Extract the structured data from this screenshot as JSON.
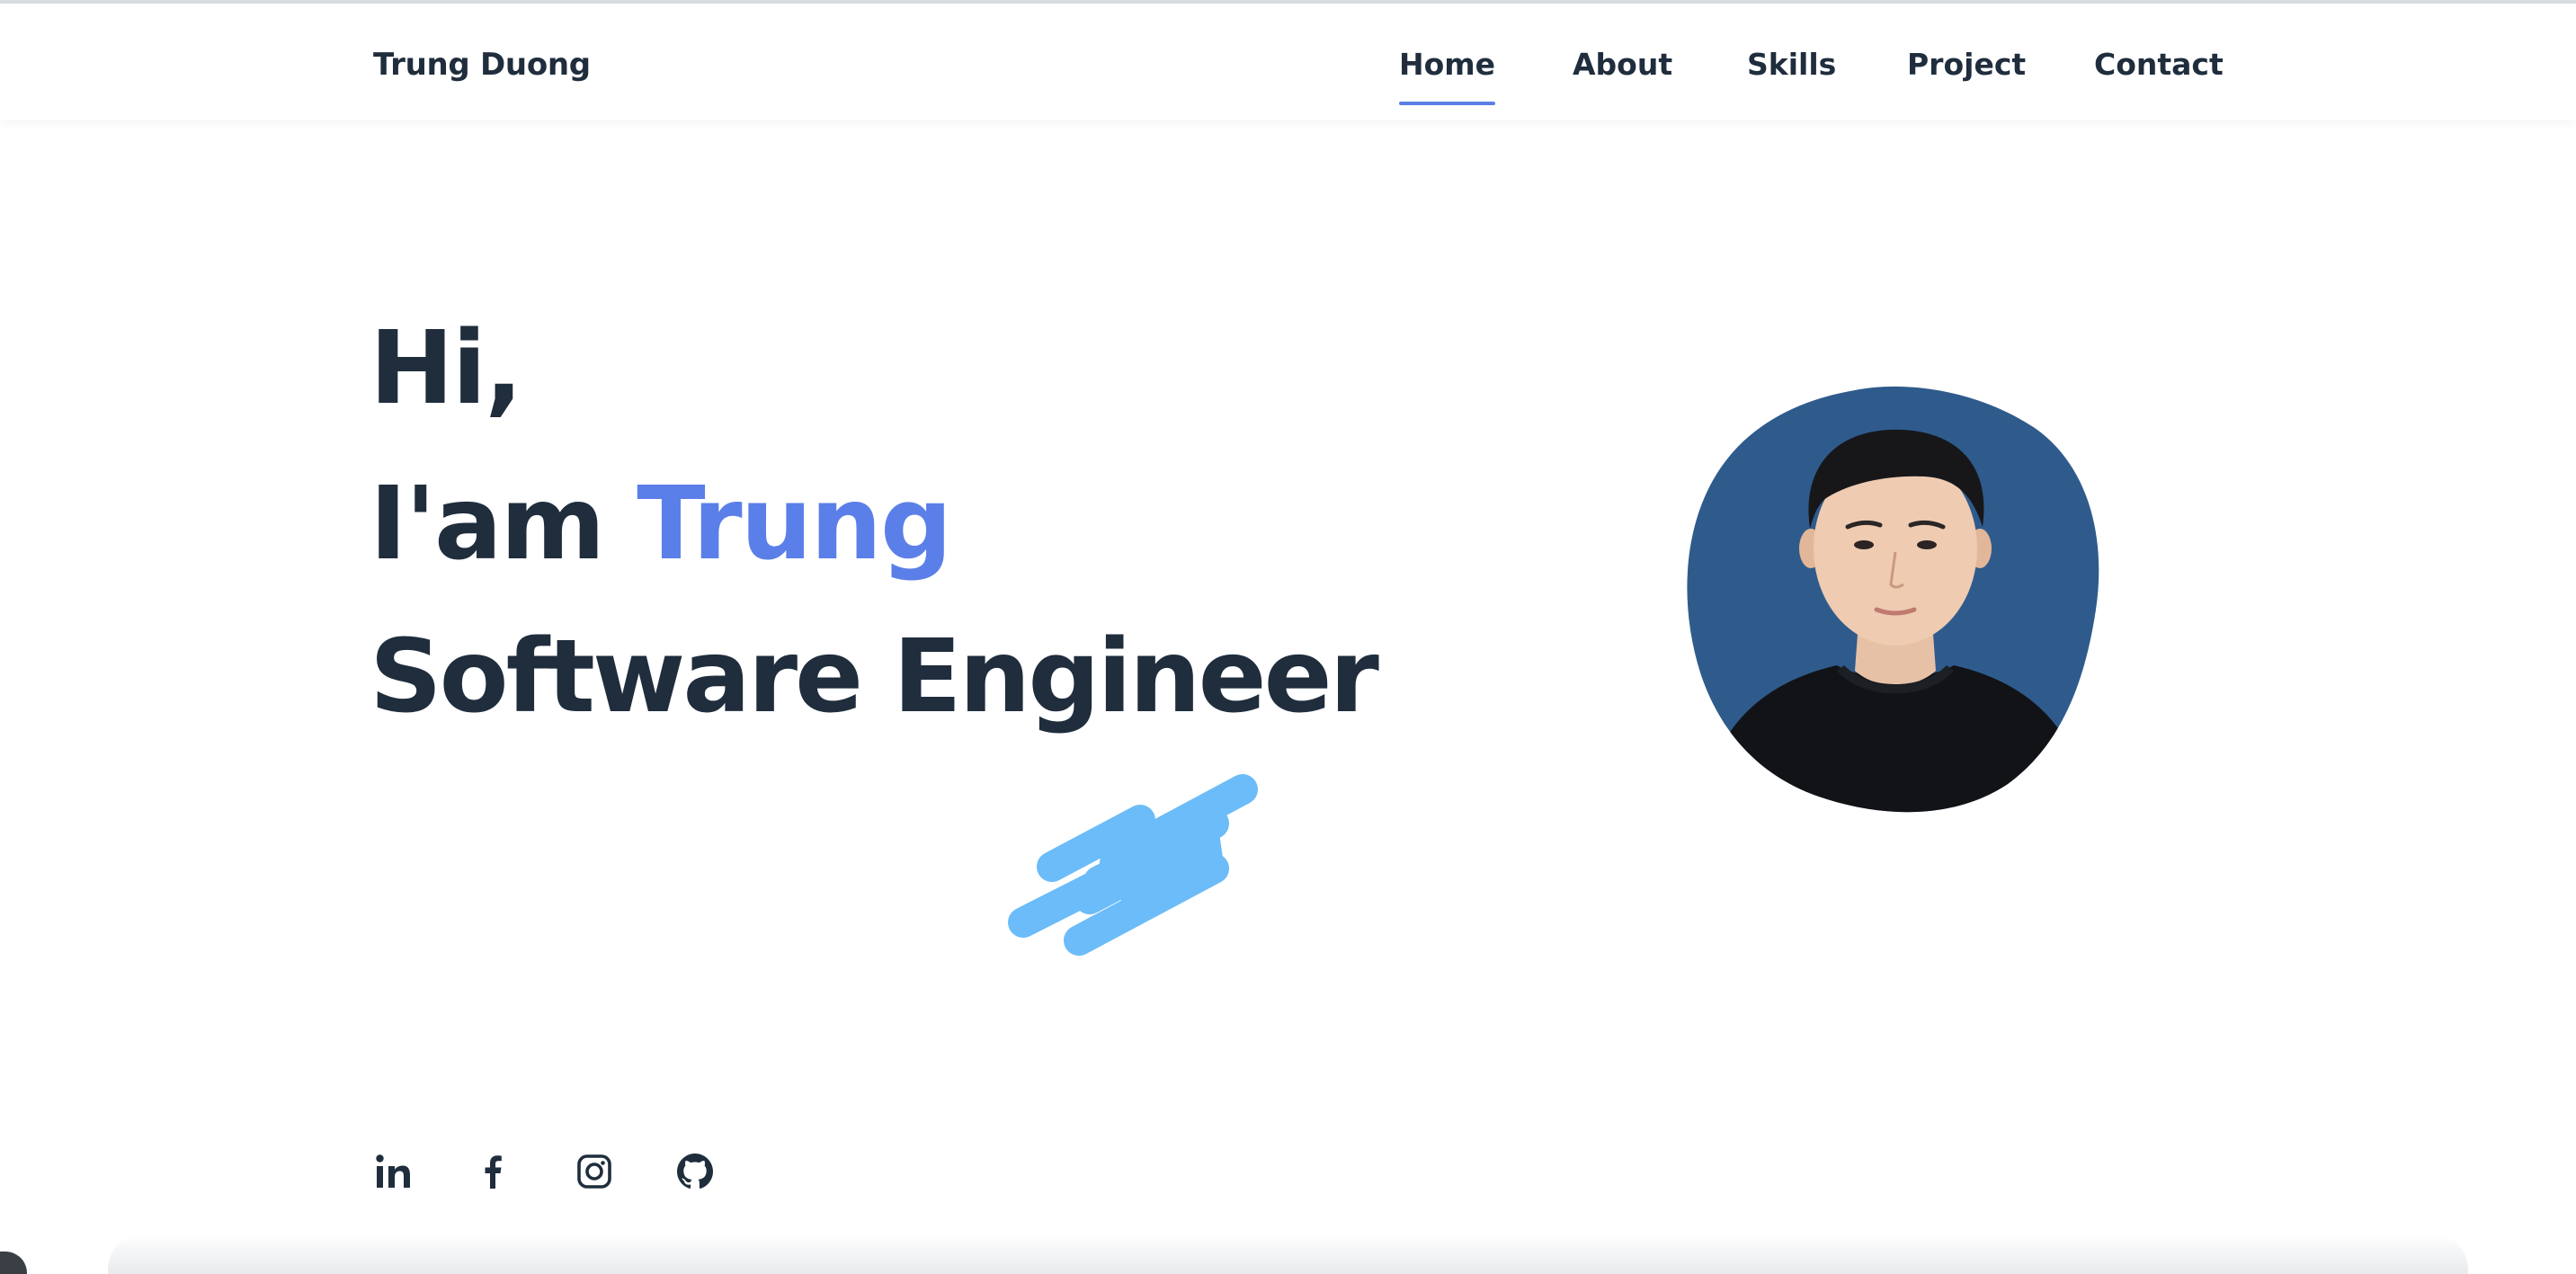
{
  "header": {
    "logo": "Trung Duong",
    "nav": {
      "home": "Home",
      "about": "About",
      "skills": "Skills",
      "project": "Project",
      "contact": "Contact"
    },
    "active_item": "Home"
  },
  "hero": {
    "greeting": "Hi,",
    "intro_prefix": "I'am ",
    "intro_name": "Trung",
    "role": "Software Engineer"
  },
  "avatar": {
    "icon": "profile-photo"
  },
  "socials": [
    {
      "icon": "linkedin-icon"
    },
    {
      "icon": "facebook-icon"
    },
    {
      "icon": "instagram-icon"
    },
    {
      "icon": "github-icon"
    }
  ],
  "colors": {
    "text_dark": "#1f2d3d",
    "accent": "#5b7fe8",
    "brush_blue": "#6bbcf8",
    "avatar_bg": "#2f5b8c"
  }
}
